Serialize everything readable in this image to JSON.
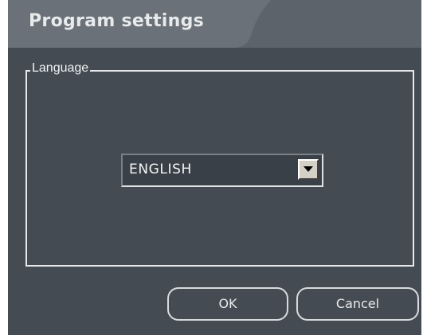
{
  "dialog": {
    "title": "Program settings"
  },
  "language_group": {
    "label": "Language",
    "select": {
      "value": "ENGLISH",
      "arrow_icon": "chevron-down-icon"
    }
  },
  "buttons": {
    "ok_label": "OK",
    "cancel_label": "Cancel"
  },
  "colors": {
    "background": "#454b52",
    "title_bar": "#5c636a",
    "border": "#e6e8ea"
  }
}
